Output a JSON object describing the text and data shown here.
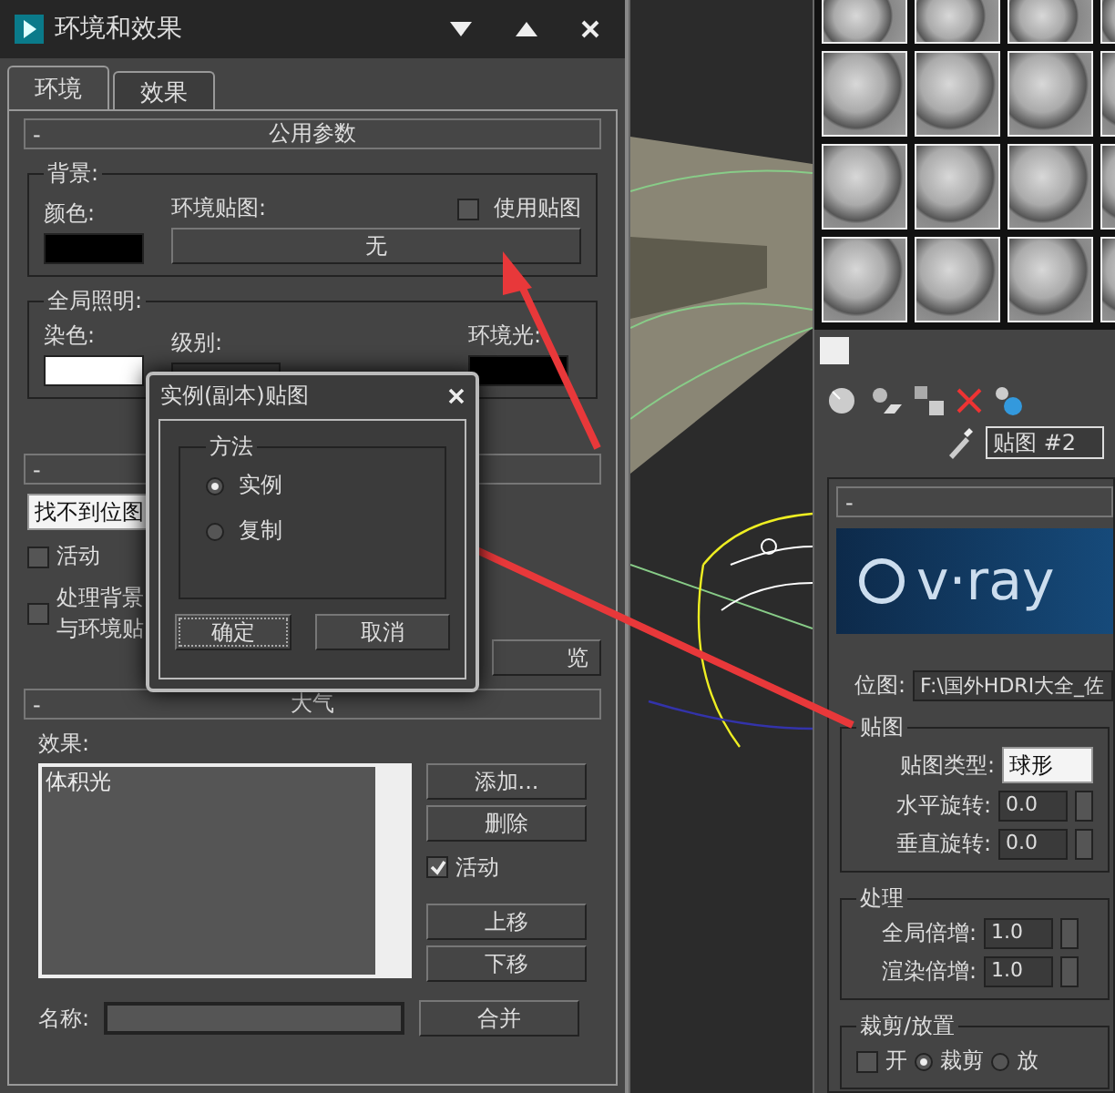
{
  "env_window": {
    "title": "环境和效果",
    "tabs": [
      {
        "label": "环境",
        "selected": true
      },
      {
        "label": "效果",
        "selected": false
      }
    ],
    "common_rollout": {
      "collapse": "-",
      "title": "公用参数",
      "background": {
        "title": "背景:",
        "color_label": "颜色:",
        "map_label": "环境贴图:",
        "map_button": "无",
        "use_map": {
          "label": "使用贴图",
          "checked": false
        }
      },
      "global_lighting": {
        "title": "全局照明:",
        "tint_label": "染色:",
        "level_label": "级别:",
        "ambient_label": "环境光:"
      }
    },
    "exposure_rollout": {
      "collapse": "-",
      "dropdown": "找不到位图",
      "active": {
        "label": "活动",
        "checked": false
      },
      "process": {
        "lines": [
          "处理背景",
          "与环境贴"
        ],
        "checked": false
      },
      "preview_button": "览"
    },
    "atmosphere_rollout": {
      "collapse": "-",
      "title": "大气",
      "effects_label": "效果:",
      "effects": [
        {
          "label": "体积光",
          "selected": false
        }
      ],
      "add_button": "添加...",
      "delete_button": "删除",
      "active": {
        "label": "活动",
        "checked": true
      },
      "up_button": "上移",
      "down_button": "下移",
      "name_label": "名称:",
      "merge_button": "合并"
    }
  },
  "dialog": {
    "title": "实例(副本)贴图",
    "group": "方法",
    "options": [
      {
        "label": "实例",
        "selected": true
      },
      {
        "label": "复制",
        "selected": false
      }
    ],
    "ok": "确定",
    "cancel": "取消"
  },
  "material_editor": {
    "map_name": "贴图 #2",
    "rollout": {
      "collapse": "-",
      "logo": "v·ray",
      "bitmap_label": "位图:",
      "bitmap_path": "F:\\国外HDRI大全_佐",
      "mapping": {
        "title": "贴图",
        "type_label": "贴图类型:",
        "type_value": "球形",
        "h_label": "水平旋转:",
        "h_value": "0.0",
        "v_label": "垂直旋转:",
        "v_value": "0.0"
      },
      "processing": {
        "title": "处理",
        "global_label": "全局倍增:",
        "global_value": "1.0",
        "render_label": "渲染倍增:",
        "render_value": "1.0"
      },
      "crop": {
        "title": "裁剪/放置",
        "on": {
          "label": "开",
          "checked": false
        },
        "options": [
          {
            "label": "裁剪",
            "selected": true
          },
          {
            "label": "放",
            "selected": false
          }
        ]
      }
    }
  }
}
